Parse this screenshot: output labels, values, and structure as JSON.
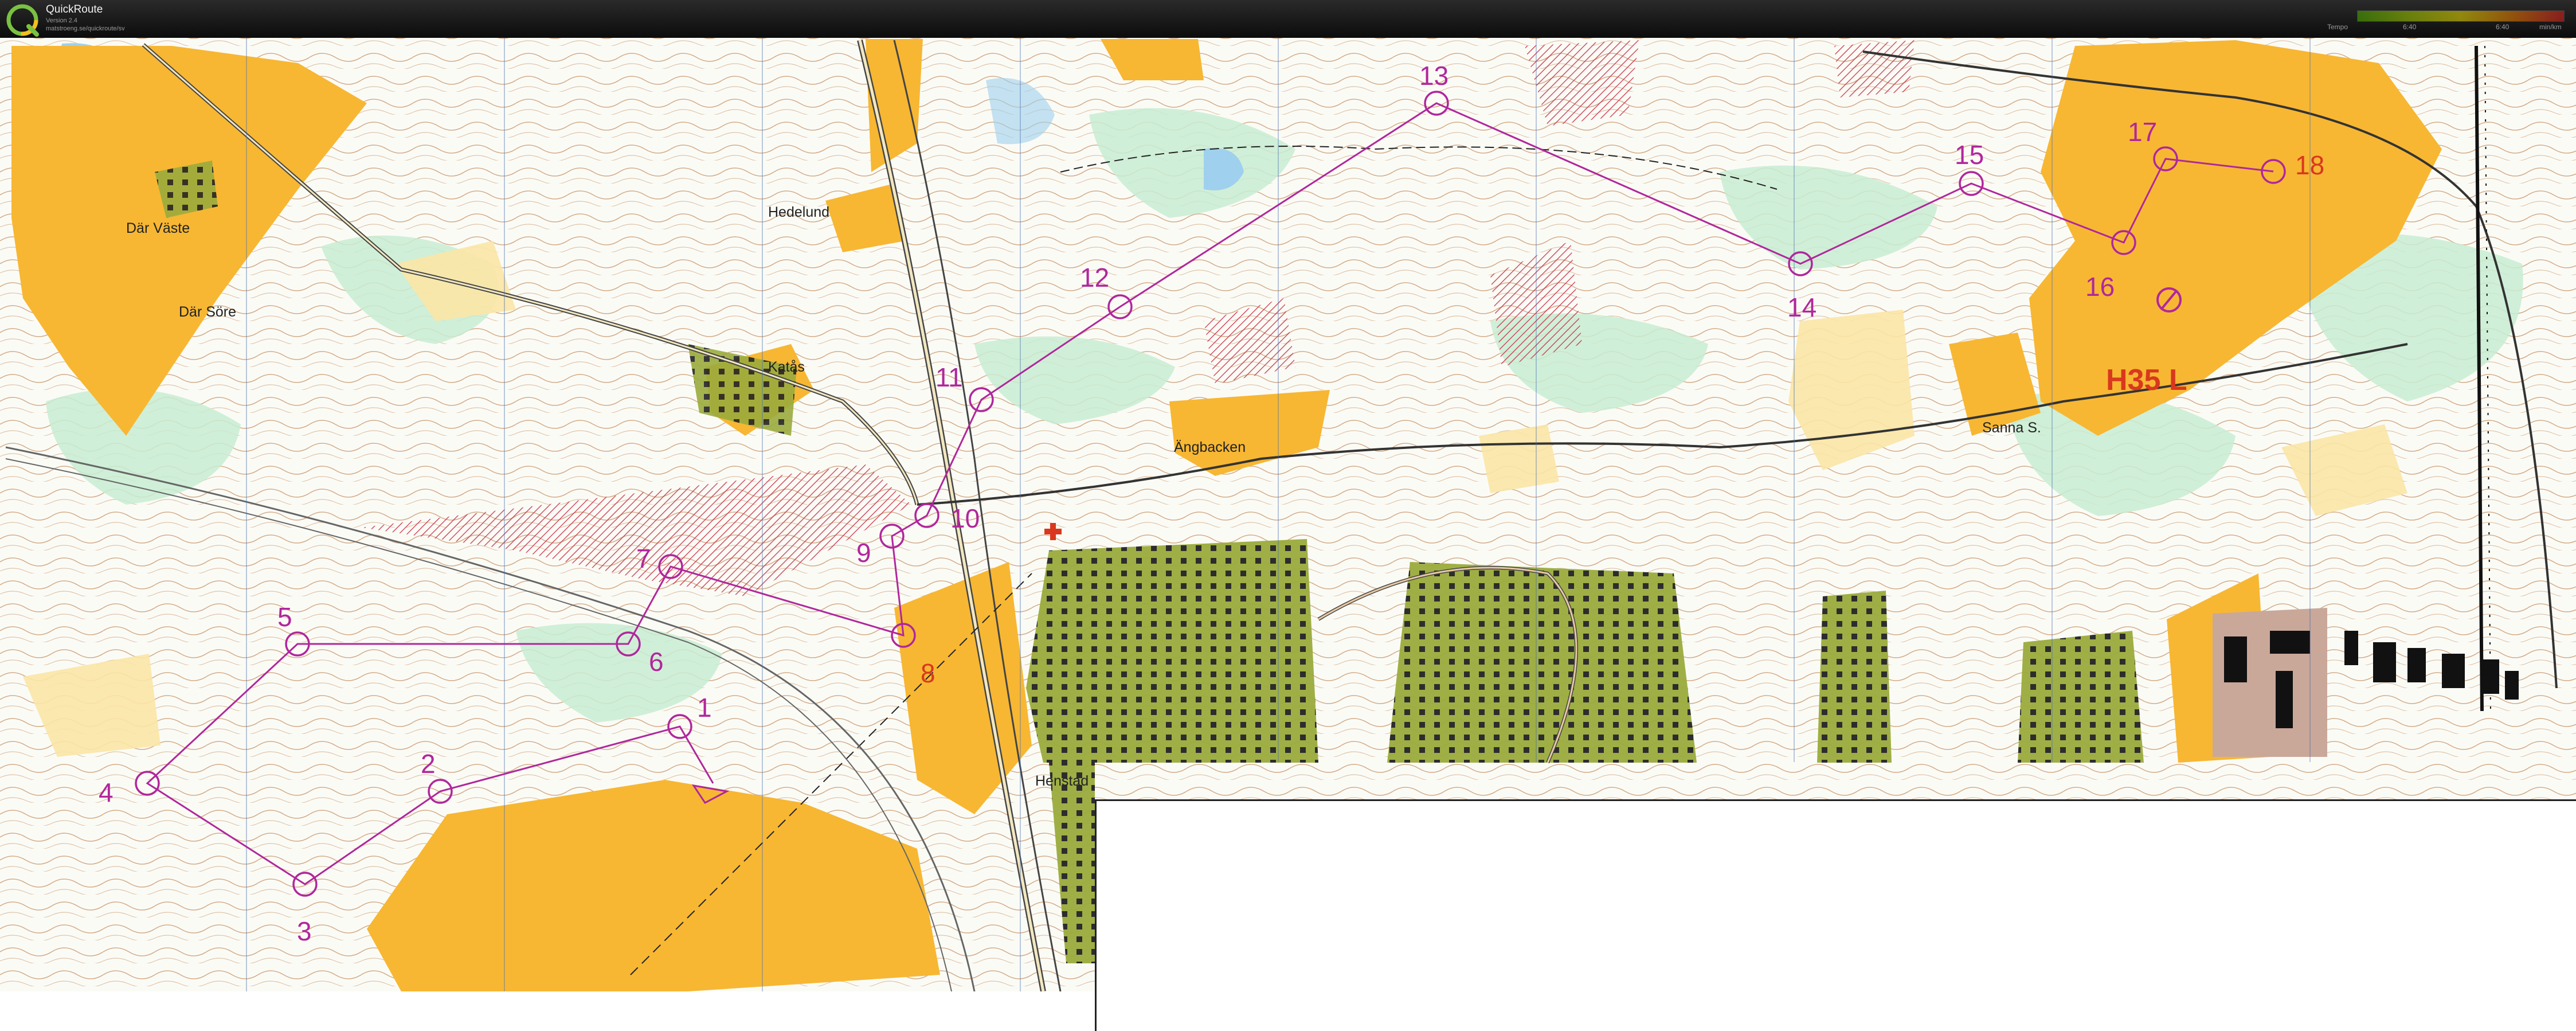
{
  "app": {
    "title": "QuickRoute",
    "version": "Version 2.4",
    "url": "matstroeng.se/quickroute/sv"
  },
  "legend": {
    "label": "Tempo",
    "tick_min": "6:40",
    "tick_max": "6:40",
    "unit": "min/km"
  },
  "map": {
    "place_names": [
      "Där Väste",
      "Där Söre",
      "Hedelund",
      "Katås",
      "Ängbacken",
      "Henstad",
      "Sanna S."
    ],
    "class_label": "H35 L",
    "controls": [
      "1",
      "2",
      "3",
      "4",
      "5",
      "6",
      "7",
      "8",
      "9",
      "10",
      "11",
      "12",
      "13",
      "14",
      "15",
      "16",
      "17",
      "18"
    ],
    "colors": {
      "course": "#b0279c",
      "open_land": "#f7b733",
      "rough_open": "#fbe6a6",
      "green": "#c8ecd2",
      "water": "#9fd0ee",
      "settlement": "#9aab3c",
      "restricted": "#c8324a"
    }
  }
}
